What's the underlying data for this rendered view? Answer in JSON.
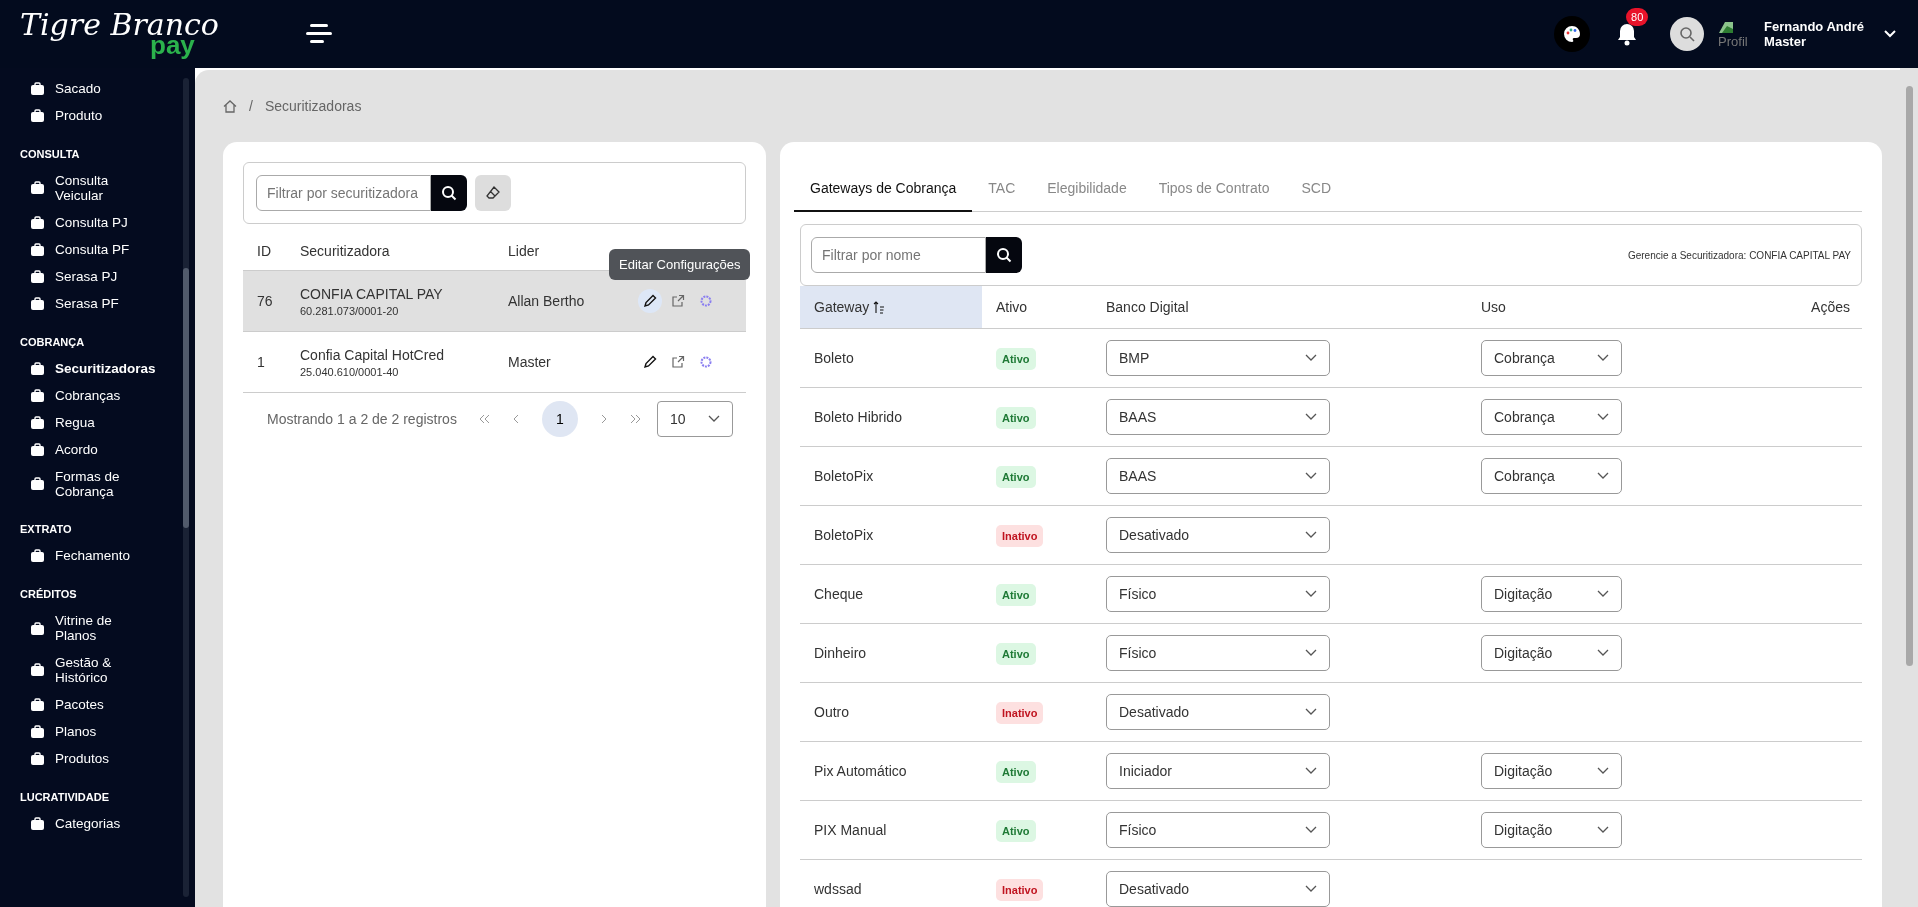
{
  "logo": {
    "name": "Tigre Branco",
    "suffix": "pay"
  },
  "header": {
    "notifications": "80",
    "profile_image_alt": "Profil",
    "user_name": "Fernando André",
    "user_role": "Master"
  },
  "sidebar": {
    "sections": [
      {
        "items": [
          {
            "label": "Sacado",
            "selected": false
          },
          {
            "label": "Produto",
            "selected": false
          }
        ]
      },
      {
        "title": "CONSULTA",
        "items": [
          {
            "label": "Consulta Veicular",
            "selected": false
          },
          {
            "label": "Consulta PJ",
            "selected": false
          },
          {
            "label": "Consulta PF",
            "selected": false
          },
          {
            "label": "Serasa PJ",
            "selected": false
          },
          {
            "label": "Serasa PF",
            "selected": false
          }
        ]
      },
      {
        "title": "COBRANÇA",
        "items": [
          {
            "label": "Securitizadoras",
            "selected": true
          },
          {
            "label": "Cobranças",
            "selected": false
          },
          {
            "label": "Regua",
            "selected": false
          },
          {
            "label": "Acordo",
            "selected": false
          },
          {
            "label": "Formas de Cobrança",
            "selected": false
          }
        ]
      },
      {
        "title": "EXTRATO",
        "items": [
          {
            "label": "Fechamento",
            "selected": false
          }
        ]
      },
      {
        "title": "CRÉDITOS",
        "items": [
          {
            "label": "Vitrine de Planos",
            "selected": false
          },
          {
            "label": "Gestão & Histórico",
            "selected": false
          },
          {
            "label": "Pacotes",
            "selected": false
          },
          {
            "label": "Planos",
            "selected": false
          },
          {
            "label": "Produtos",
            "selected": false
          }
        ]
      },
      {
        "title": "LUCRATIVIDADE",
        "items": [
          {
            "label": "Categorias",
            "selected": false
          }
        ]
      }
    ]
  },
  "breadcrumb_separator": "/",
  "breadcrumb": [
    "Securitizadoras"
  ],
  "securitizadoras": {
    "filter_placeholder": "Filtrar por securitizadora",
    "columns": [
      "ID",
      "Securitizadora",
      "Lider"
    ],
    "rows": [
      {
        "id": "76",
        "name": "CONFIA CAPITAL PAY",
        "cnpj": "60.281.073/0001-20",
        "lider": "Allan Bertho",
        "selected": true
      },
      {
        "id": "1",
        "name": "Confia Capital HotCred",
        "cnpj": "25.040.610/0001-40",
        "lider": "Master",
        "selected": false
      }
    ],
    "tooltip": "Editar Configurações",
    "summary": "Mostrando 1 a 2 de 2 registros",
    "pages": [
      {
        "label": "1",
        "selected": true
      }
    ],
    "page_size": "10"
  },
  "config": {
    "tabs": [
      {
        "label": "Gateways de Cobrança",
        "selected": true
      },
      {
        "label": "TAC",
        "selected": false
      },
      {
        "label": "Elegibilidade",
        "selected": false
      },
      {
        "label": "Tipos de Contrato",
        "selected": false
      },
      {
        "label": "SCD",
        "selected": false
      }
    ],
    "filter_placeholder": "Filtrar por nome",
    "managing": "Gerencie a Securitizadora: CONFIA CAPITAL PAY",
    "columns": [
      "Gateway",
      "Ativo",
      "Banco Digital",
      "Uso",
      "Ações"
    ],
    "rows": [
      {
        "gateway": "Boleto",
        "status": "Ativo",
        "active": true,
        "banco": "BMP",
        "uso": "Cobrança"
      },
      {
        "gateway": "Boleto Hibrido",
        "status": "Ativo",
        "active": true,
        "banco": "BAAS",
        "uso": "Cobrança"
      },
      {
        "gateway": "BoletoPix",
        "status": "Ativo",
        "active": true,
        "banco": "BAAS",
        "uso": "Cobrança"
      },
      {
        "gateway": "BoletoPix",
        "status": "Inativo",
        "active": false,
        "banco": "Desativado"
      },
      {
        "gateway": "Cheque",
        "status": "Ativo",
        "active": true,
        "banco": "Físico",
        "uso": "Digitação"
      },
      {
        "gateway": "Dinheiro",
        "status": "Ativo",
        "active": true,
        "banco": "Físico",
        "uso": "Digitação"
      },
      {
        "gateway": "Outro",
        "status": "Inativo",
        "active": false,
        "banco": "Desativado"
      },
      {
        "gateway": "Pix Automático",
        "status": "Ativo",
        "active": true,
        "banco": "Iniciador",
        "uso": "Digitação"
      },
      {
        "gateway": "PIX Manual",
        "status": "Ativo",
        "active": true,
        "banco": "Físico",
        "uso": "Digitação"
      },
      {
        "gateway": "wdssad",
        "status": "Inativo",
        "active": false,
        "banco": "Desativado"
      }
    ]
  }
}
